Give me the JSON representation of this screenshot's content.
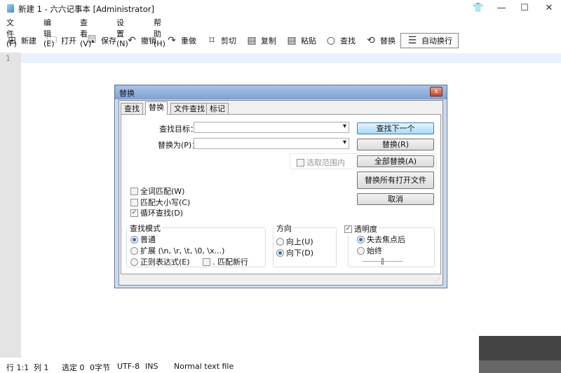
{
  "window": {
    "title": "新建 1 - 六六记事本 [Administrator]",
    "skin": "👕",
    "minimize": "—",
    "maximize": "☐",
    "close": "✕"
  },
  "menu": [
    "文件(F)",
    "编辑(E)",
    "查看(V)",
    "设置(N)",
    "帮助(H)"
  ],
  "toolbar": [
    {
      "label": "新建",
      "icon": "⊞"
    },
    {
      "label": "打开",
      "icon": "🗀"
    },
    {
      "label": "保存",
      "icon": "🖫"
    },
    {
      "label": "撤销",
      "icon": "↶"
    },
    {
      "label": "重做",
      "icon": "↷"
    },
    {
      "label": "剪切",
      "icon": "⌑"
    },
    {
      "label": "复制",
      "icon": "▤"
    },
    {
      "label": "粘贴",
      "icon": "▤"
    },
    {
      "label": "查找",
      "icon": "○"
    },
    {
      "label": "替换",
      "icon": "⟲"
    },
    {
      "label": "自动换行",
      "icon": "☰"
    }
  ],
  "editor": {
    "line_number": "1"
  },
  "status": {
    "line": "行 1:1",
    "col": "列 1",
    "sel": "选定 0",
    "bytes": "0字节",
    "enc": "UTF-8",
    "mode": "INS",
    "type": "Normal text file"
  },
  "dialog": {
    "title": "替换",
    "close": "x",
    "tabs": [
      "查找",
      "替换",
      "文件查找",
      "标记"
    ],
    "find_label": "查找目标：",
    "find_value": "",
    "replace_label": "替换为(P)：",
    "replace_value": "",
    "in_selection": "选取范围内",
    "buttons": {
      "find_next": "查找下一个",
      "replace": "替换(R)",
      "replace_all": "全部替换(A)",
      "replace_all_open": "替换所有打开文件",
      "cancel": "取消"
    },
    "options": {
      "whole_word": "全词匹配(W)",
      "match_case": "匹配大小写(C)",
      "wrap": "循环查找(D)"
    },
    "search_mode": {
      "title": "查找模式",
      "normal": "普通",
      "extended": "扩展 (\\n, \\r, \\t, \\0, \\x...)",
      "regex": "正则表达式(E)",
      "dot_newline": ". 匹配新行"
    },
    "direction": {
      "title": "方向",
      "up": "向上(U)",
      "down": "向下(D)"
    },
    "transparency": {
      "title": "透明度",
      "on_lose_focus": "失去焦点后",
      "always": "始终",
      "level": 0.5
    }
  }
}
